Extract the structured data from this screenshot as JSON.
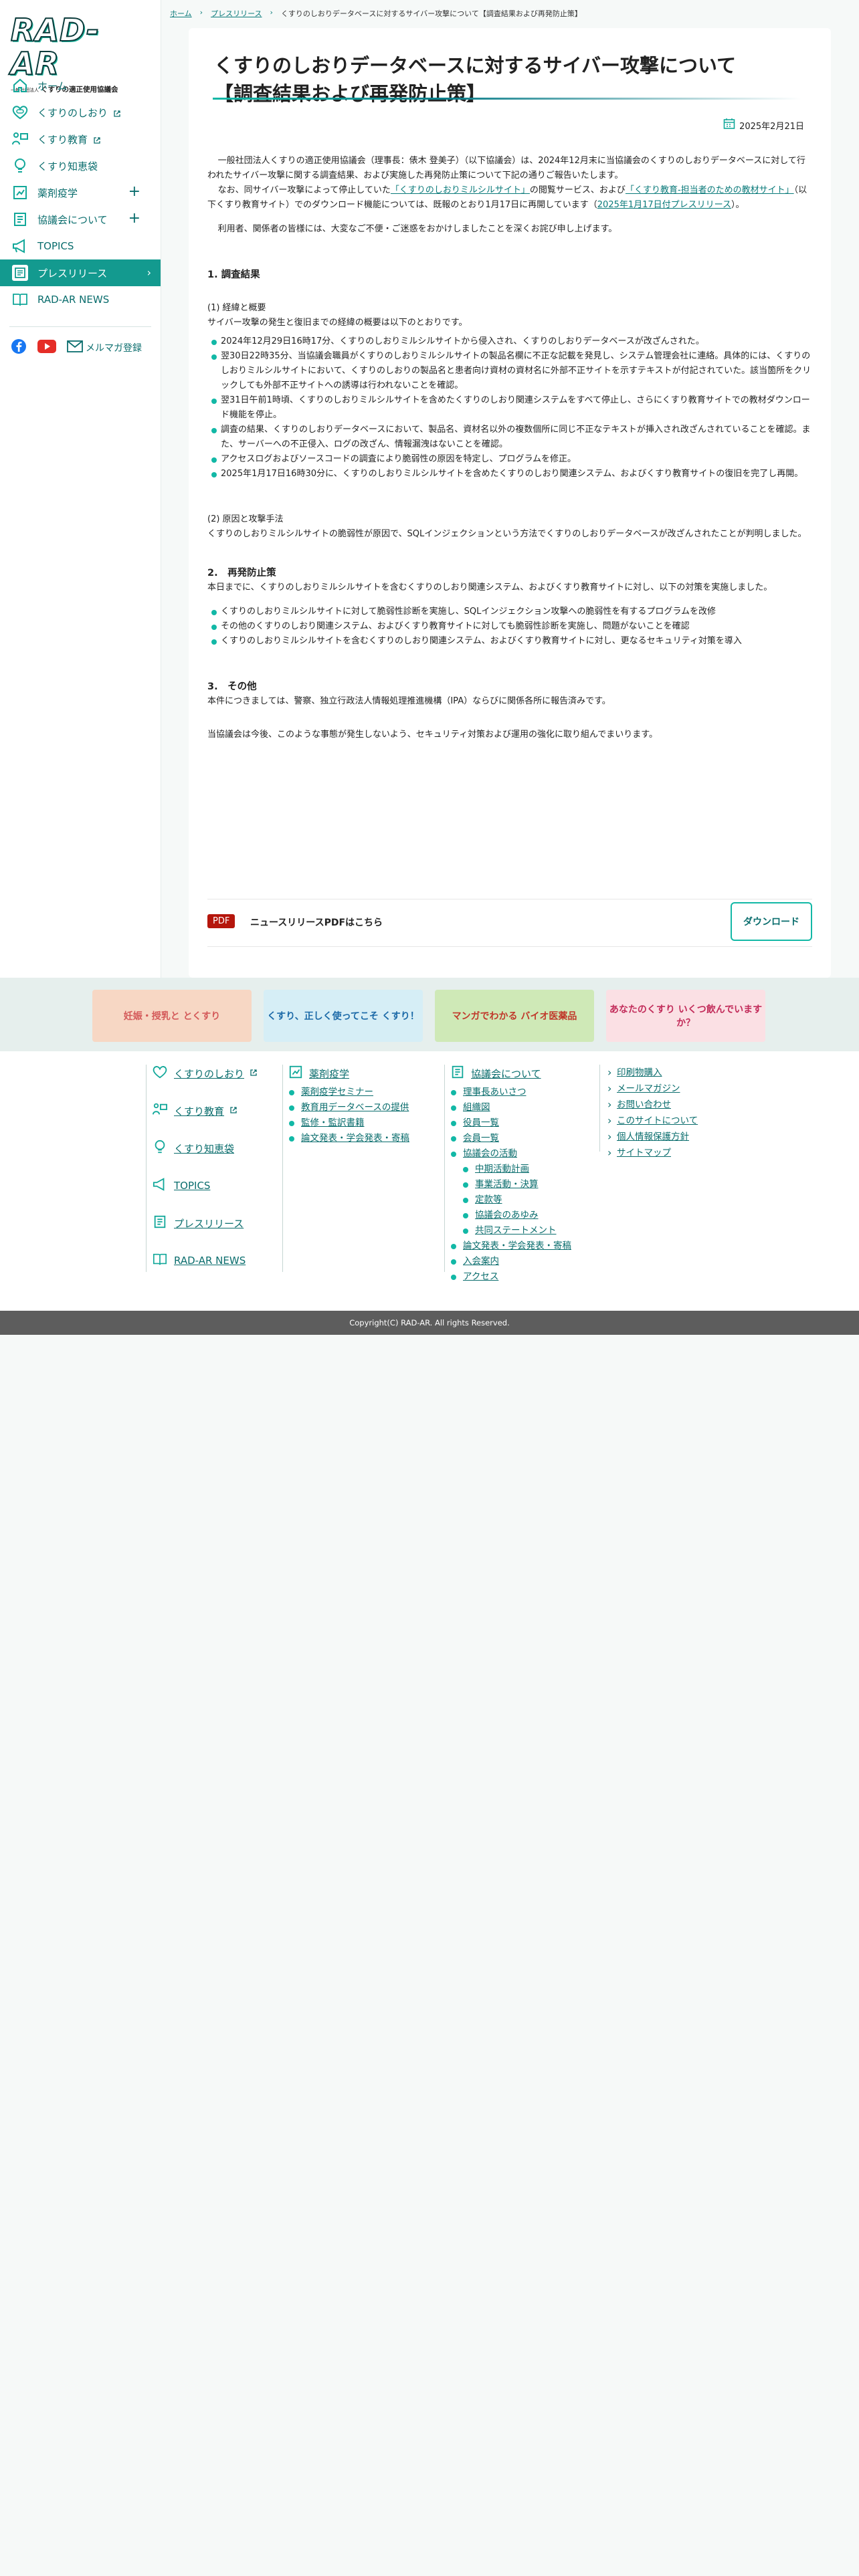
{
  "brand": {
    "logo_text": "RAD-AR",
    "org_prefix": "一般社団法人",
    "org_name": "くすりの適正使用協議会"
  },
  "sidebar": {
    "items": [
      {
        "label": "ホーム"
      },
      {
        "label": "くすりのしおり"
      },
      {
        "label": "くすり教育"
      },
      {
        "label": "くすり知恵袋"
      },
      {
        "label": "薬剤疫学",
        "expand": "+"
      },
      {
        "label": "協議会について",
        "expand": "+"
      },
      {
        "label": "TOPICS"
      },
      {
        "label": "プレスリリース"
      },
      {
        "label": "RAD-AR NEWS"
      }
    ],
    "mail_label": "メルマガ登録"
  },
  "breadcrumb": {
    "home": "ホーム",
    "press": "プレスリリース",
    "current": "くすりのしおりデータベースに対するサイバー攻撃について【調査結果および再発防止策】",
    "separator": "›"
  },
  "article": {
    "title_line1": "くすりのしおりデータベースに対するサイバー攻撃について",
    "title_line2": "【調査結果および再発防止策】",
    "date": "2025年2月21日",
    "intro1": "一般社団法人くすりの適正使用協議会（理事長：俵木 登美子）（以下協議会）は、2024年12月末に当協議会のくすりのしおりデータベースに対して行われたサイバー攻撃に関する調査結果、および実施した再発防止策について下記の通りご報告いたします。",
    "intro2_a": "なお、同サイバー攻撃によって停止していた",
    "intro2_link1": "「くすりのしおりミルシルサイト」",
    "intro2_b": "の閲覧サービス、および",
    "intro2_link2": "「くすり教育-担当者のための教材サイト」",
    "intro2_c": "（以下くすり教育サイト）でのダウンロード機能については、既報のとおり1月17日に再開しています（",
    "intro2_link3": "2025年1月17日付プレスリリース",
    "intro2_d": "）。",
    "apology": "利用者、関係者の皆様には、大変なご不便・ご迷惑をおかけしましたことを深くお詫び申し上げます。",
    "s1_heading": "1. 調査結果",
    "s1_sub1": "(1) 経緯と概要",
    "s1_sub1_text": "サイバー攻撃の発生と復旧までの経緯の概要は以下のとおりです。",
    "s1_bullets": [
      "2024年12月29日16時17分、くすりのしおりミルシルサイトから侵入され、くすりのしおりデータベースが改ざんされた。",
      "翌30日22時35分、当協議会職員がくすりのしおりミルシルサイトの製品名欄に不正な記載を発見し、システム管理会社に連絡。具体的には、くすりのしおりミルシルサイトにおいて、くすりのしおりの製品名と患者向け資材の資材名に外部不正サイトを示すテキストが付記されていた。該当箇所をクリックしても外部不正サイトへの誘導は行われないことを確認。",
      "翌31日午前1時頃、くすりのしおりミルシルサイトを含めたくすりのしおり関連システムをすべて停止し、さらにくすり教育サイトでの教材ダウンロード機能を停止。",
      "調査の結果、くすりのしおりデータベースにおいて、製品名、資材名以外の複数個所に同じ不正なテキストが挿入され改ざんされていることを確認。また、サーバーへの不正侵入、ログの改ざん、情報漏洩はないことを確認。",
      "アクセスログおよびソースコードの調査により脆弱性の原因を特定し、プログラムを修正。",
      "2025年1月17日16時30分に、くすりのしおりミルシルサイトを含めたくすりのしおり関連システム、およびくすり教育サイトの復旧を完了し再開。"
    ],
    "s1_sub2": "(2) 原因と攻撃手法",
    "s1_sub2_text": "くすりのしおりミルシルサイトの脆弱性が原因で、SQLインジェクションという方法でくすりのしおりデータベースが改ざんされたことが判明しました。",
    "s2_heading": "2.　再発防止策",
    "s2_text": "本日までに、くすりのしおりミルシルサイトを含むくすりのしおり関連システム、およびくすり教育サイトに対し、以下の対策を実施しました。",
    "s2_bullets": [
      "くすりのしおりミルシルサイトに対して脆弱性診断を実施し、SQLインジェクション攻撃への脆弱性を有するプログラムを改修",
      "その他のくすりのしおり関連システム、およびくすり教育サイトに対しても脆弱性診断を実施し、問題がないことを確認",
      "くすりのしおりミルシルサイトを含むくすりのしおり関連システム、およびくすり教育サイトに対し、更なるセキュリティ対策を導入"
    ],
    "s3_heading": "3.　その他",
    "s3_text1": "本件につきましては、警察、独立行政法人情報処理推進機構（IPA）ならびに関係各所に報告済みです。",
    "s3_text2": "当協議会は今後、このような事態が発生しないよう、セキュリティ対策および運用の強化に取り組んでまいります。",
    "pdf_badge": "PDF",
    "pdf_label": "ニュースリリースPDFはこちら",
    "download_label": "ダウンロード"
  },
  "banners": [
    {
      "text": "妊娠・授乳と とくすり",
      "color": "#f7d7c4"
    },
    {
      "text": "くすり、正しく使ってこそ くすり！",
      "color": "#d6eef6"
    },
    {
      "text": "マンガでわかる バイオ医薬品",
      "color": "#cfe9b7"
    },
    {
      "text": "あなたのくすり いくつ飲んでいますか？",
      "color": "#fbe0e4"
    }
  ],
  "footer": {
    "col1": [
      "くすりのしおり",
      "くすり教育",
      "くすり知恵袋",
      "TOPICS",
      "プレスリリース",
      "RAD-AR NEWS"
    ],
    "col2_title": "薬剤疫学",
    "col2_items": [
      "薬剤疫学セミナー",
      "教育用データベースの提供",
      "監修・監訳書籍",
      "論文発表・学会発表・寄稿"
    ],
    "col3_title": "協議会について",
    "col3_items_a": [
      "理事長あいさつ",
      "組織図",
      "役員一覧",
      "会員一覧",
      "協議会の活動"
    ],
    "col3_nested": [
      "中期活動計画",
      "事業活動・決算",
      "定款等",
      "協議会のあゆみ",
      "共同ステートメント"
    ],
    "col3_items_b": [
      "論文発表・学会発表・寄稿",
      "入会案内",
      "アクセス"
    ],
    "col4_items": [
      "印刷物購入",
      "メールマガジン",
      "お問い合わせ",
      "このサイトについて",
      "個人情報保護方針",
      "サイトマップ"
    ]
  },
  "copyright": "Copyright(C) RAD-AR. All rights Reserved."
}
